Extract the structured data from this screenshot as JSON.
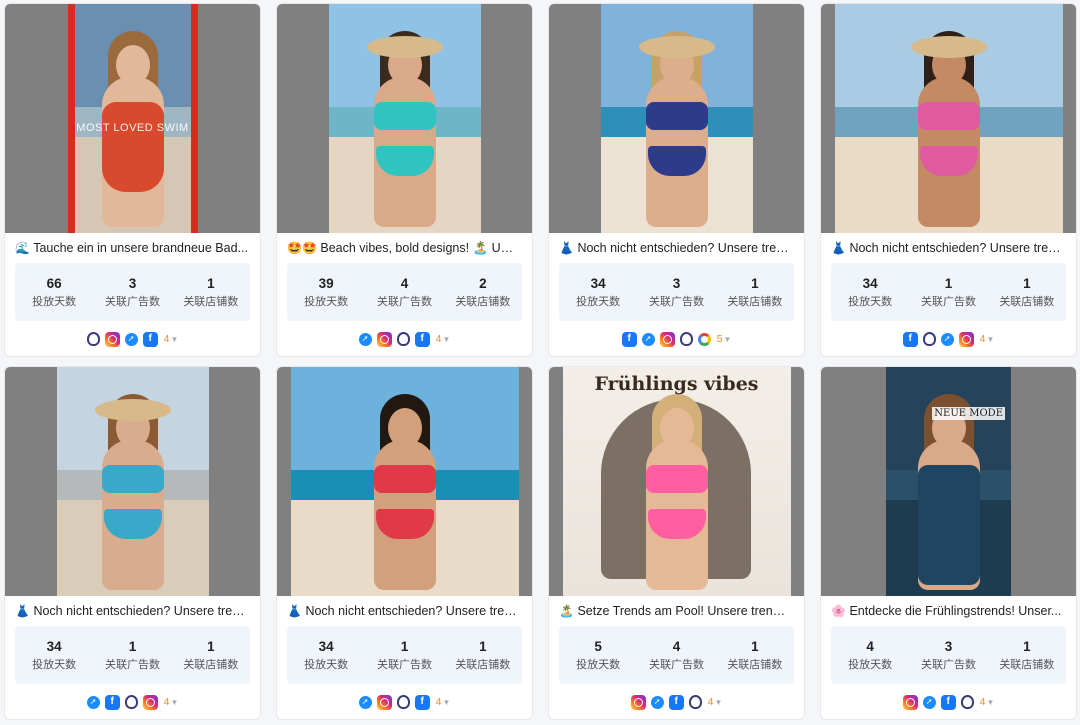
{
  "labels": {
    "days": "投放天数",
    "ads": "关联广告数",
    "stores": "关联店铺数"
  },
  "cards": [
    {
      "emoji": "🌊",
      "title": "Tauche ein in unsere brandneue Bad...",
      "days": "66",
      "ads": "3",
      "stores": "1",
      "platforms": [
        "threads",
        "instagram",
        "messenger",
        "facebook"
      ],
      "more": "4",
      "overlay": "MOST LOVED SWIM",
      "swim_color": "#d9492e"
    },
    {
      "emoji": "🤩🤩",
      "title": "Beach vibes, bold designs! 🏝️ Unv...",
      "days": "39",
      "ads": "4",
      "stores": "2",
      "platforms": [
        "messenger",
        "instagram",
        "threads",
        "facebook"
      ],
      "more": "4",
      "swim_color": "#2fc4c0"
    },
    {
      "emoji": "👗",
      "title": "Noch nicht entschieden? Unsere tren...",
      "days": "34",
      "ads": "3",
      "stores": "1",
      "platforms": [
        "facebook",
        "messenger",
        "instagram",
        "threads",
        "audience"
      ],
      "more": "5",
      "swim_color": "#2d3b8a"
    },
    {
      "emoji": "👗",
      "title": "Noch nicht entschieden? Unsere tren...",
      "days": "34",
      "ads": "1",
      "stores": "1",
      "platforms": [
        "facebook",
        "threads",
        "messenger",
        "instagram"
      ],
      "more": "4",
      "swim_color": "#e05aa0"
    },
    {
      "emoji": "👗",
      "title": "Noch nicht entschieden? Unsere tren...",
      "days": "34",
      "ads": "1",
      "stores": "1",
      "platforms": [
        "messenger",
        "facebook",
        "threads",
        "instagram"
      ],
      "more": "4",
      "swim_color": "#3aa8c8"
    },
    {
      "emoji": "👗",
      "title": "Noch nicht entschieden? Unsere tren...",
      "days": "34",
      "ads": "1",
      "stores": "1",
      "platforms": [
        "messenger",
        "instagram",
        "threads",
        "facebook"
      ],
      "more": "4",
      "swim_color": "#e0394a"
    },
    {
      "emoji": "🏝️",
      "title": "Setze Trends am Pool! Unsere trendi...",
      "days": "5",
      "ads": "4",
      "stores": "1",
      "platforms": [
        "instagram",
        "messenger",
        "facebook",
        "threads"
      ],
      "more": "4",
      "overlay": "Frühlings vibes",
      "swim_color": "#ff5fa0"
    },
    {
      "emoji": "🌸",
      "title": "Entdecke die Frühlingstrends! Unser...",
      "days": "4",
      "ads": "3",
      "stores": "1",
      "platforms": [
        "instagram",
        "messenger",
        "facebook",
        "threads"
      ],
      "more": "4",
      "overlay": "NEUE MODE",
      "swim_color": "#1f4560"
    }
  ]
}
